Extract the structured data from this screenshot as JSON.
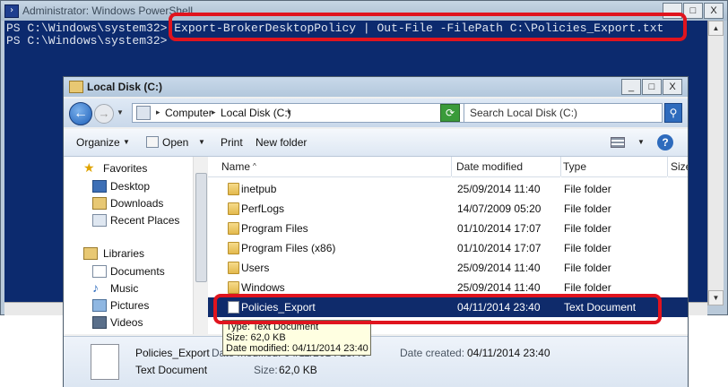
{
  "powershell": {
    "title": "Administrator: Windows PowerShell",
    "lines": [
      "PS C:\\Windows\\system32> Export-BrokerDesktopPolicy | Out-File -FilePath C:\\Policies_Export.txt",
      "PS C:\\Windows\\system32>"
    ],
    "controls": {
      "minimize": "_",
      "maximize": "□",
      "close": "X"
    }
  },
  "explorer": {
    "title": "Local Disk (C:)",
    "controls": {
      "minimize": "_",
      "maximize": "□",
      "close": "X"
    },
    "breadcrumb": [
      "Computer",
      "Local Disk (C:)"
    ],
    "search_placeholder": "Search Local Disk (C:)",
    "toolbar": {
      "organize": "Organize",
      "open": "Open",
      "print": "Print",
      "new_folder": "New folder"
    },
    "nav": {
      "favorites_label": "Favorites",
      "favorites": [
        "Desktop",
        "Downloads",
        "Recent Places"
      ],
      "libraries_label": "Libraries",
      "libraries": [
        "Documents",
        "Music",
        "Pictures",
        "Videos"
      ]
    },
    "columns": {
      "name": "Name",
      "date": "Date modified",
      "type": "Type",
      "size": "Size"
    },
    "files": [
      {
        "name": "inetpub",
        "date": "25/09/2014 11:40",
        "type": "File folder",
        "icon": "folder-icon"
      },
      {
        "name": "PerfLogs",
        "date": "14/07/2009 05:20",
        "type": "File folder",
        "icon": "folder-icon"
      },
      {
        "name": "Program Files",
        "date": "01/10/2014 17:07",
        "type": "File folder",
        "icon": "folder-icon"
      },
      {
        "name": "Program Files (x86)",
        "date": "01/10/2014 17:07",
        "type": "File folder",
        "icon": "folder-icon"
      },
      {
        "name": "Users",
        "date": "25/09/2014 11:40",
        "type": "File folder",
        "icon": "folder-icon"
      },
      {
        "name": "Windows",
        "date": "25/09/2014 11:40",
        "type": "File folder",
        "icon": "folder-icon"
      },
      {
        "name": "Policies_Export",
        "date": "04/11/2014 23:40",
        "type": "Text Document",
        "icon": "text-document-icon",
        "selected": true
      }
    ],
    "tooltip": {
      "type": "Type: Text Document",
      "size": "Size: 62,0 KB",
      "modified": "Date modified: 04/11/2014 23:40"
    },
    "details": {
      "name": "Policies_Export",
      "date_modified_label": "Date modified: 04/11/2014 23:40",
      "date_created_label": "Date created:",
      "date_created": "04/11/2014 23:40",
      "type": "Text Document",
      "size_label": "Size:",
      "size": "62,0 KB"
    }
  },
  "highlight_color": "#e0141e",
  "selection_color": "#0f2b6b"
}
